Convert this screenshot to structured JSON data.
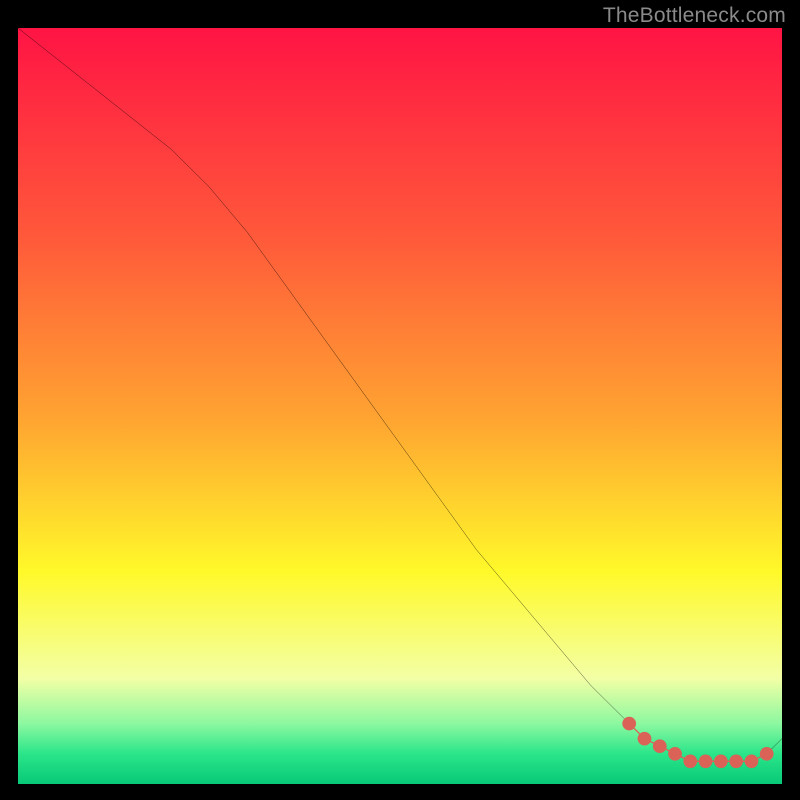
{
  "watermark": {
    "text": "TheBottleneck.com"
  },
  "colors": {
    "red_top": "#ff1444",
    "orange": "#ffa531",
    "yellow": "#fff92a",
    "pale": "#f3ffa5",
    "green_light": "#8cf8a0",
    "green": "#2be58a",
    "green_deep": "#07c977",
    "curve": "#000000",
    "marker": "#da6257"
  },
  "chart_data": {
    "type": "line",
    "title": "",
    "xlabel": "",
    "ylabel": "",
    "xlim": [
      0,
      100
    ],
    "ylim": [
      0,
      100
    ],
    "grid": false,
    "legend": false,
    "series": [
      {
        "name": "bottleneck-curve",
        "x": [
          0,
          5,
          10,
          15,
          20,
          25,
          30,
          35,
          40,
          45,
          50,
          55,
          60,
          65,
          70,
          75,
          80,
          82,
          84,
          86,
          88,
          90,
          92,
          94,
          96,
          98,
          100
        ],
        "y": [
          100,
          96,
          92,
          88,
          84,
          79,
          73,
          66,
          59,
          52,
          45,
          38,
          31,
          25,
          19,
          13,
          8,
          6,
          5,
          4,
          3,
          3,
          3,
          3,
          3,
          4,
          6
        ]
      }
    ],
    "markers": {
      "name": "highlighted-range",
      "x": [
        80,
        82,
        84,
        86,
        88,
        90,
        92,
        94,
        96,
        98
      ],
      "y": [
        8,
        6,
        5,
        4,
        3,
        3,
        3,
        3,
        3,
        4
      ]
    }
  }
}
